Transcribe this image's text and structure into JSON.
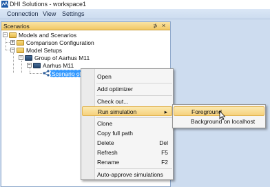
{
  "window": {
    "title": "DHI Solutions - workspace1"
  },
  "menubar": [
    "Connection",
    "View",
    "Settings"
  ],
  "panel": {
    "title": "Scenarios",
    "pin_glyph": "⊅",
    "close_glyph": "×"
  },
  "tree": {
    "root": "Models and Scenarios",
    "comparison": "Comparison Configuration",
    "model_setups": "Model Setups",
    "group": "Group of Aarhus M11",
    "aarhus": "Aarhus M11",
    "selected": "Scenario of Aarhus M11"
  },
  "context_menu": {
    "items": [
      {
        "label": "Open",
        "shortcut": ""
      },
      {
        "label": "Add optimizer",
        "shortcut": ""
      },
      {
        "label": "Check out...",
        "shortcut": ""
      },
      {
        "label": "Run simulation",
        "shortcut": ""
      },
      {
        "label": "Clone",
        "shortcut": ""
      },
      {
        "label": "Copy full path",
        "shortcut": ""
      },
      {
        "label": "Delete",
        "shortcut": "Del"
      },
      {
        "label": "Refresh",
        "shortcut": "F5"
      },
      {
        "label": "Rename",
        "shortcut": "F2"
      },
      {
        "label": "Auto-approve simulations",
        "shortcut": ""
      }
    ],
    "submenu_arrow": "▸"
  },
  "submenu": {
    "items": [
      "Foreground",
      "Background on localhost"
    ]
  },
  "colors": {
    "menubar": "#cddcef",
    "panel_header": "#f2c864",
    "selection": "#3399ff",
    "hover": "#f6d17d"
  }
}
